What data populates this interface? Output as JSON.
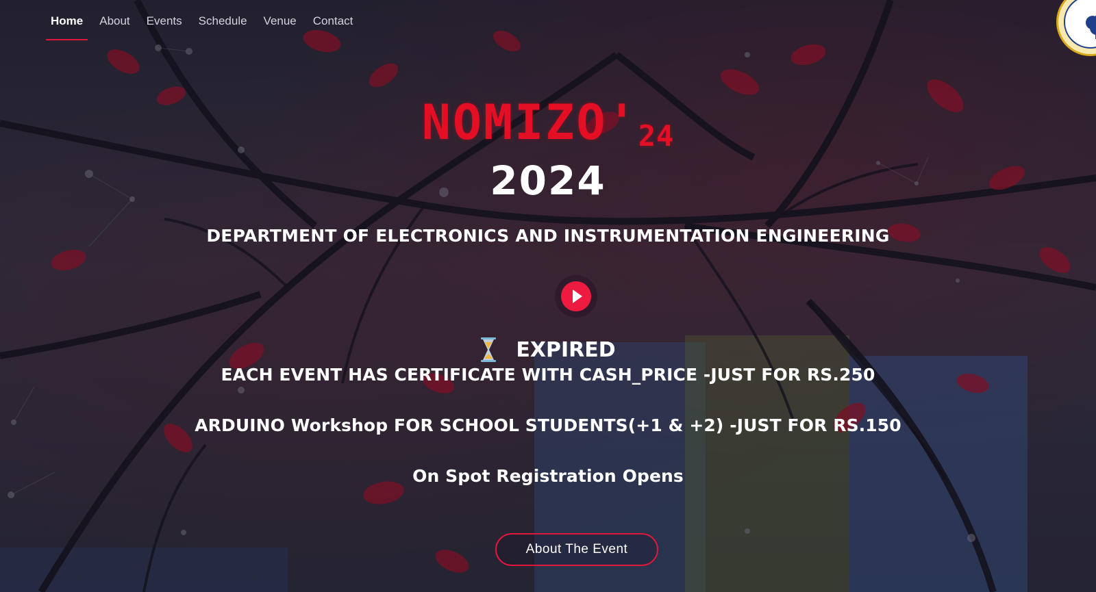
{
  "nav": {
    "items": [
      {
        "label": "Home",
        "active": true
      },
      {
        "label": "About",
        "active": false
      },
      {
        "label": "Events",
        "active": false
      },
      {
        "label": "Schedule",
        "active": false
      },
      {
        "label": "Venue",
        "active": false
      },
      {
        "label": "Contact",
        "active": false
      }
    ]
  },
  "hero": {
    "brand": "NOMIZO'",
    "brand_suffix": "24",
    "year": "2024",
    "department": "DEPARTMENT OF ELECTRONICS AND INSTRUMENTATION ENGINEERING",
    "play_icon": "play-icon",
    "countdown_icon": "hourglass-icon",
    "countdown_status": "EXPIRED",
    "announcements": [
      "EACH EVENT HAS CERTIFICATE WITH CASH_PRICE -JUST FOR RS.250",
      "ARDUINO Workshop FOR SCHOOL STUDENTS(+1 & +2) -JUST FOR RS.150",
      "On Spot Registration Opens"
    ],
    "cta_label": "About The Event"
  },
  "colors": {
    "accent": "#e0163c",
    "brand_red": "#e40f24",
    "text": "#ffffff"
  }
}
